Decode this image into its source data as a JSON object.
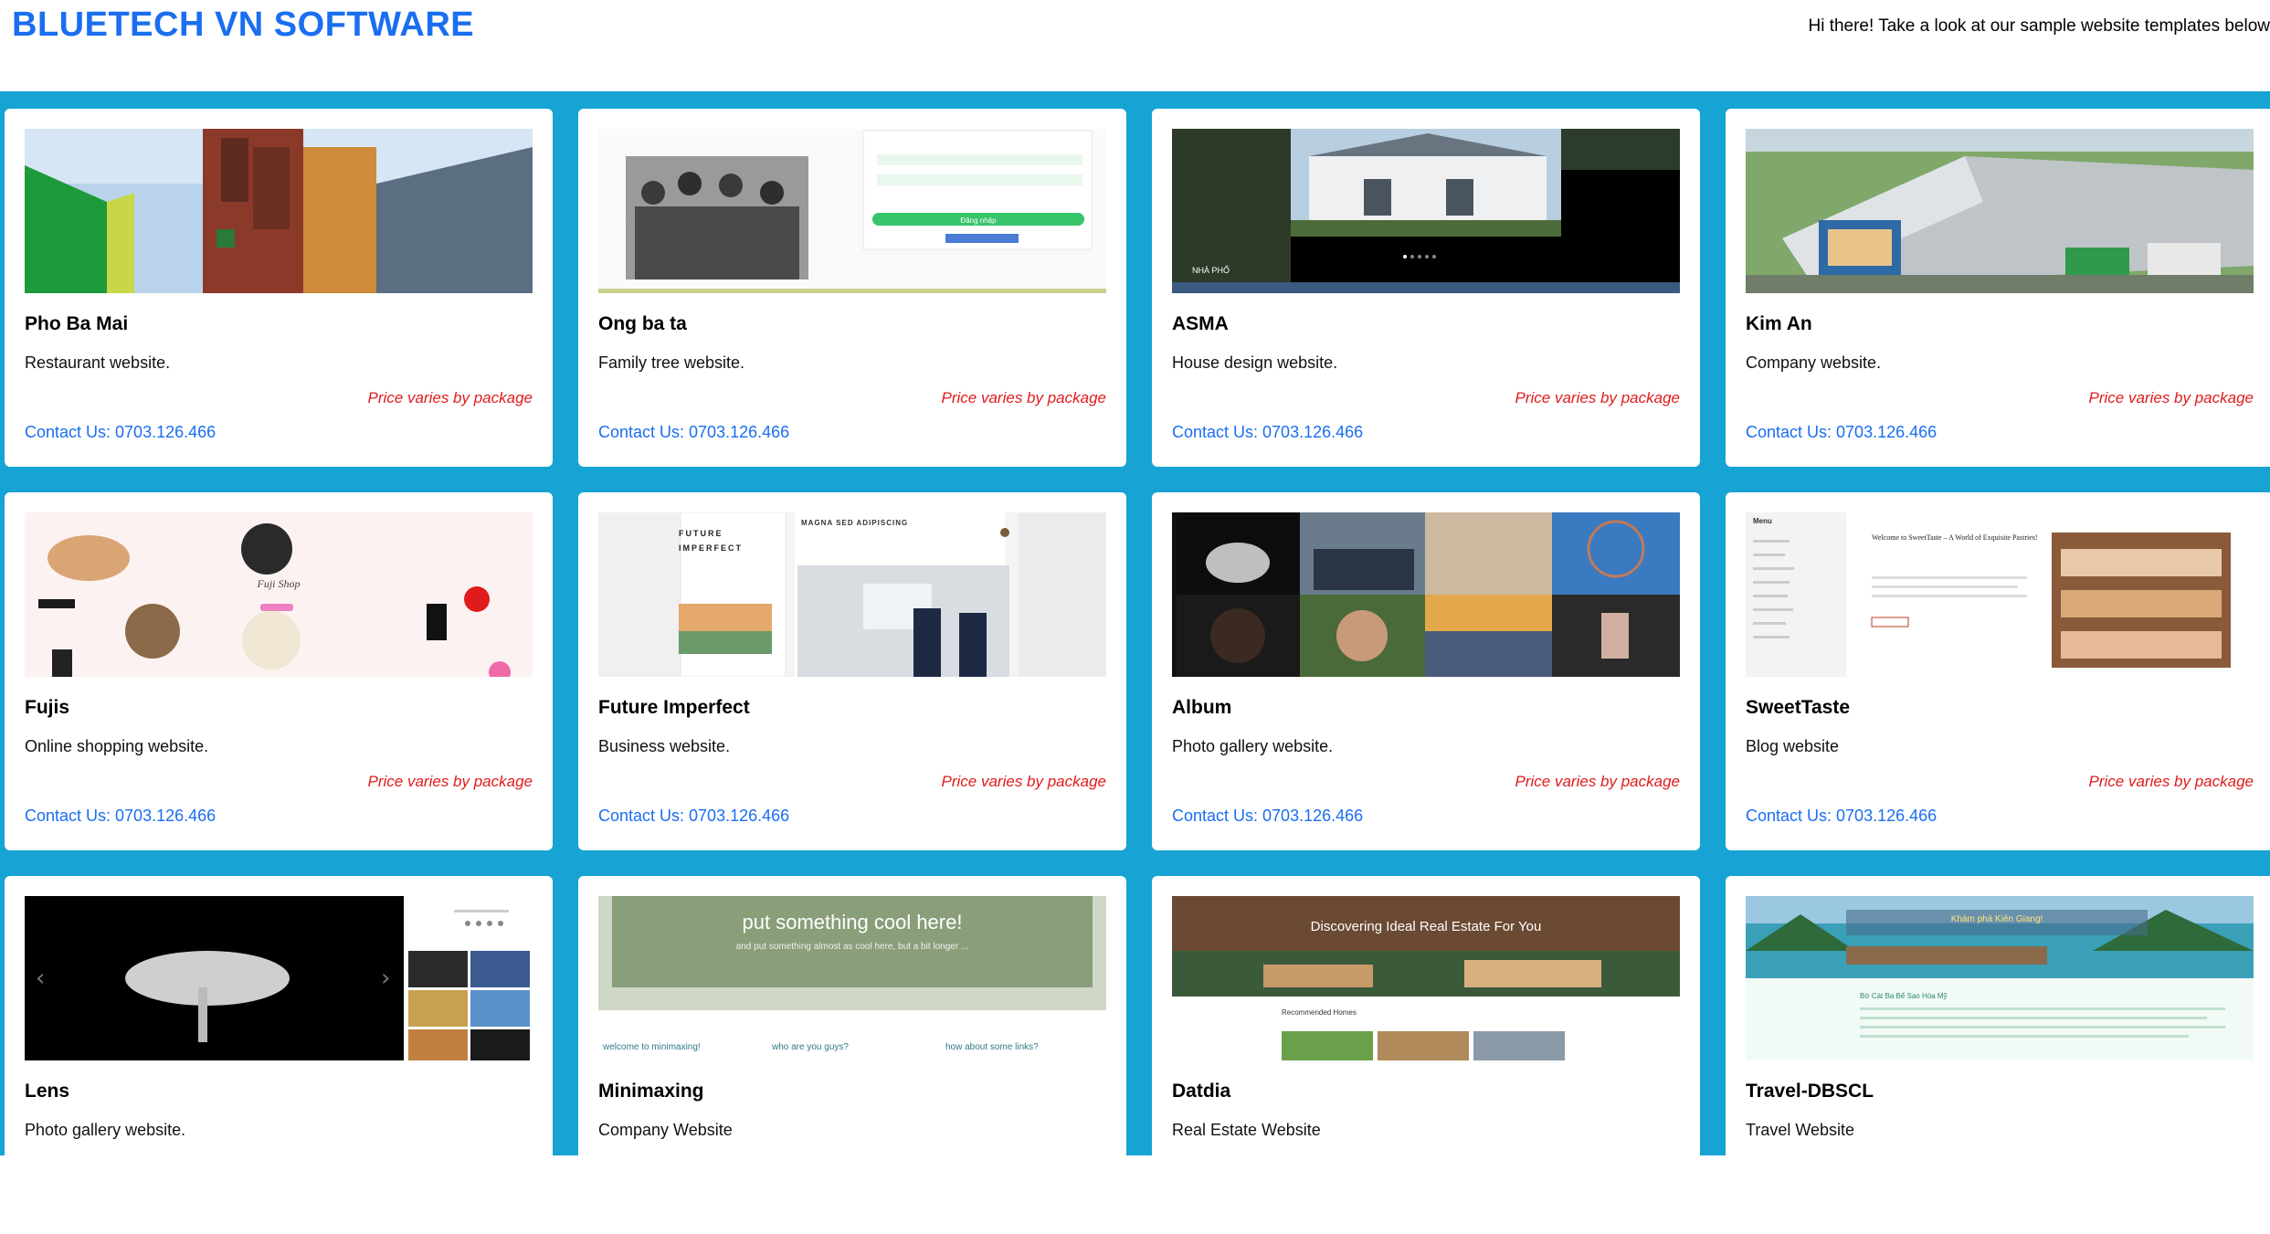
{
  "header": {
    "brand": "BLUETECH VN SOFTWARE",
    "tagline": "Hi there! Take a look at our sample website templates below"
  },
  "common": {
    "price_note": "Price varies by package",
    "contact": "Contact Us: 0703.126.466"
  },
  "cards": [
    {
      "title": "Pho Ba Mai",
      "desc": "Restaurant website."
    },
    {
      "title": "Ong ba ta",
      "desc": "Family tree website."
    },
    {
      "title": "ASMA",
      "desc": "House design website."
    },
    {
      "title": "Kim An",
      "desc": "Company website."
    },
    {
      "title": "Fujis",
      "desc": "Online shopping website."
    },
    {
      "title": "Future Imperfect",
      "desc": "Business website."
    },
    {
      "title": "Album",
      "desc": "Photo gallery website."
    },
    {
      "title": "SweetTaste",
      "desc": "Blog website"
    },
    {
      "title": "Lens",
      "desc": "Photo gallery website."
    },
    {
      "title": "Minimaxing",
      "desc": "Company Website"
    },
    {
      "title": "Datdia",
      "desc": "Real Estate Website"
    },
    {
      "title": "Travel-DBSCL",
      "desc": "Travel Website"
    }
  ],
  "thumbs": {
    "ongbata_login": "Đăng nhập",
    "asma_caption": "NHÀ PHỐ",
    "fujis_shop": "Fuji Shop",
    "future_title_1": "FUTURE",
    "future_title_2": "IMPERFECT",
    "future_heading": "MAGNA SED ADIPISCING",
    "sweet_menu": "Menu",
    "sweet_heading": "Welcome to SweetTaste – A World of Exquisite Pastries!",
    "mini_headline": "put something cool here!",
    "mini_sub": "and put something almost as cool here, but a bit longer ...",
    "mini_link_1": "welcome to minimaxing!",
    "mini_link_2": "who are you guys?",
    "mini_link_3": "how about some links?",
    "datdia_headline": "Discovering Ideal Real Estate For You",
    "datdia_sub": "Recommended Homes",
    "travel_headline": "Khám phá Kiên Giang!",
    "travel_sub": "Bờ Cát Ba Bể Sao Hòa Mỹ"
  }
}
